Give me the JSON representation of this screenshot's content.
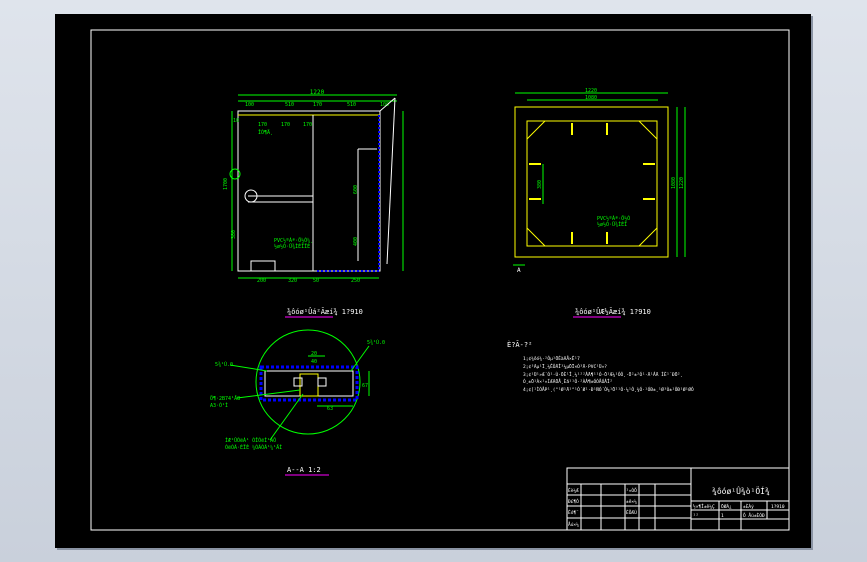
{
  "views": {
    "front": {
      "top_dims": [
        "100",
        "510",
        "170",
        "510",
        "100"
      ],
      "overall_width": "1220",
      "inner_dims": [
        "170",
        "170",
        "170"
      ],
      "left_dims": [
        "10",
        "1700",
        "380"
      ],
      "right_dims": [
        "600",
        "400"
      ],
      "bottom_dims": [
        "200",
        "320",
        "50",
        "250"
      ],
      "note_lines": [
        "PVC½ºÁª·Ö½Ó¼¸",
        "½ø½Ó·Ü¾ÌÉÏÏÉ"
      ],
      "small_label": "ÎÒ¶Ä¸",
      "caption": "¾ôóø¹Ûá²Ãæí¾  1?910"
    },
    "plan": {
      "top_dims": [
        "1220",
        "1080"
      ],
      "side_dims": [
        "800",
        "1080",
        "1220"
      ],
      "left_dim": "380",
      "note_lines": [
        "PVC½ºÁª·Ö½Ó",
        "½ø½Ó·Ü¾ÌÉÏ"
      ],
      "marker": "A",
      "caption": "¾ôóø¹ÛÆ½Ãæí¾  1?910"
    },
    "section": {
      "callouts": [
        "5¾¹Ù.0",
        "5¾¹Ù.0",
        "Ö¶·2B74¹Å8",
        "A3·Ó¹Ì",
        "ÍÆ¹ÛÓëÁ¹ ÓÎÓëÍ¹ÀÔ",
        "ÓëÓÃ·ÉÏÈ ¼ÓÃÒÃ¹¼¹ÄÍ"
      ],
      "dims": [
        "20",
        "40",
        "67",
        "63"
      ],
      "caption": "A--A  1:2"
    }
  },
  "notes": {
    "title": "È?Ã-?²",
    "lines": [
      "1¡¢¾ôó¾·²Ôµ¹ÖÈàÃÅ×Ê¹7",
      "2¡¢³Ãµ¹Ï¸¼ÊÔÄÎ³¼µÖÏ×Ò³Ä·PVC¹Ü»?",
      "3¡¢¹Ü¹»Æ´Ó¹·Ù·ÖÈ¹Î¸¼¹²²ÂÄ¶¹¹Ó·Ö¹Æ¼¹ÔÔ¸·Ö²±²Ó¹·Ä¹ÂÄ ÍÈ¹´ÐÖ²¸",
      "   Ó¸±Ö¹À×¹»ÍÆÃÖÅ¸Èã¹¹Ô·²ÀÂ¶±ÓÓÅÓÂÎ²",
      "4¡¢[¹ÌÓÅP¹¸(°¹Ø¹Ä¹°¹Ó´Ø¹·Ð¹ÑÓ´Ô¼¹Ö²¹Ó·¼¹Ô¸¾Ó·¹ÓÐ±¸¹Ø³Ù±¹ÔÐ¹Ø¹ØÔ"
    ]
  },
  "title_block": {
    "title": "¾ôóø¹Û¾ò¹ÖÍ¾",
    "left_rows": [
      "Éè¼Æ",
      "Ð£¶Ô",
      "Éó¶¨",
      "Åú×¼"
    ],
    "mid_rows": [
      "¹¤ÒÕ",
      "±ê×¼",
      "ÈÕÆÚ"
    ],
    "small_cells": [
      "½×¶Î±ê¼Ç",
      "ÖØÁ¿",
      "±ÈÀý",
      "1?910"
    ],
    "bottom_cells": [
      "¹²",
      "1",
      "Õ Åú±ÈÓÐ"
    ]
  },
  "colors": {
    "sheet": "#000000",
    "border": "#ffffff",
    "outline": "#ffff00",
    "dimension": "#00ff00",
    "hidden": "#0000ff",
    "caption_line": "#ff00ff",
    "note": "#00ffff"
  }
}
